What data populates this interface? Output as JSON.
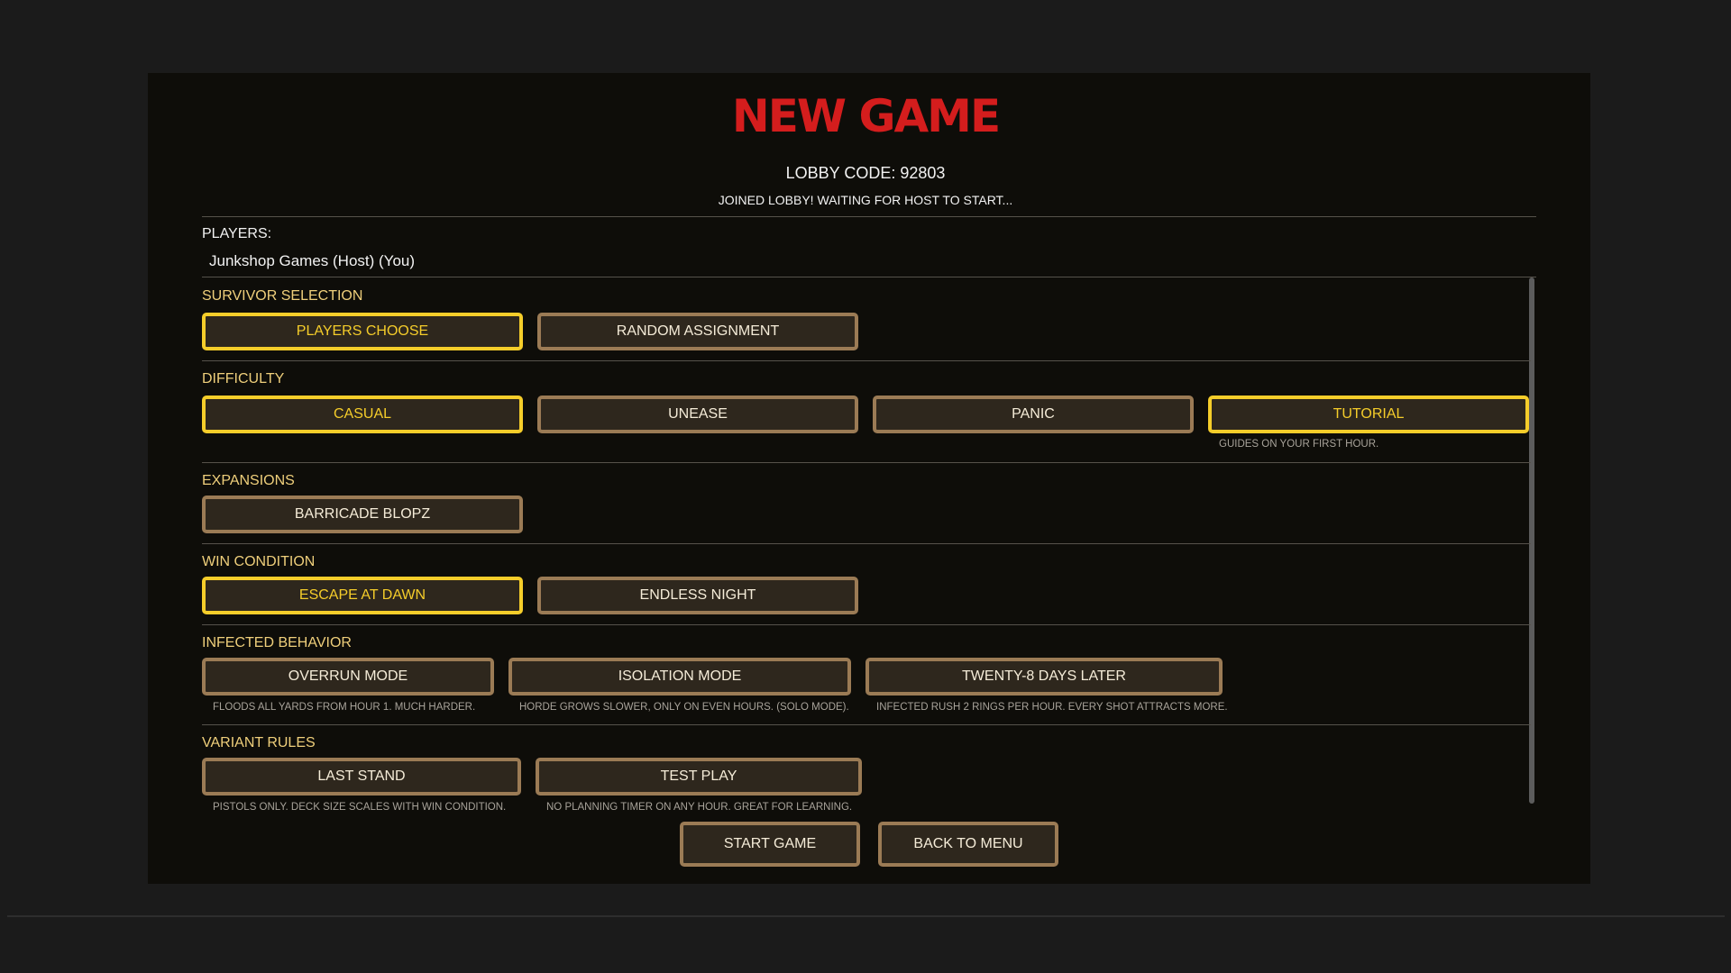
{
  "header": {
    "title": "NEW GAME",
    "lobby_code": "LOBBY CODE: 92803",
    "status": "JOINED LOBBY! WAITING FOR HOST TO START..."
  },
  "players": {
    "label": "PLAYERS:",
    "list": [
      "Junkshop Games (Host) (You)"
    ]
  },
  "sections": {
    "survivor": {
      "label": "SURVIVOR SELECTION",
      "options": [
        {
          "label": "PLAYERS CHOOSE",
          "selected": true
        },
        {
          "label": "RANDOM ASSIGNMENT",
          "selected": false
        }
      ]
    },
    "difficulty": {
      "label": "DIFFICULTY",
      "options": [
        {
          "label": "CASUAL",
          "selected": true
        },
        {
          "label": "UNEASE",
          "selected": false
        },
        {
          "label": "PANIC",
          "selected": false
        },
        {
          "label": "TUTORIAL",
          "selected": true,
          "hint": "GUIDES ON YOUR FIRST HOUR."
        }
      ]
    },
    "expansions": {
      "label": "EXPANSIONS",
      "options": [
        {
          "label": "BARRICADE BLOPZ",
          "selected": false
        }
      ]
    },
    "win_condition": {
      "label": "WIN CONDITION",
      "options": [
        {
          "label": "ESCAPE AT DAWN",
          "selected": true
        },
        {
          "label": "ENDLESS NIGHT",
          "selected": false
        }
      ]
    },
    "infected_behavior": {
      "label": "INFECTED BEHAVIOR",
      "options": [
        {
          "label": "OVERRUN MODE",
          "selected": false,
          "hint": "FLOODS ALL YARDS FROM HOUR 1. MUCH HARDER."
        },
        {
          "label": "ISOLATION MODE",
          "selected": false,
          "hint": "HORDE GROWS SLOWER, ONLY ON EVEN HOURS. (SOLO MODE)."
        },
        {
          "label": "TWENTY-8 DAYS LATER",
          "selected": false,
          "hint": "INFECTED RUSH 2 RINGS PER HOUR. EVERY SHOT ATTRACTS MORE."
        }
      ]
    },
    "variant_rules": {
      "label": "VARIANT RULES",
      "options": [
        {
          "label": "LAST STAND",
          "selected": false,
          "hint": "PISTOLS ONLY. DECK SIZE SCALES WITH WIN CONDITION."
        },
        {
          "label": "TEST PLAY",
          "selected": false,
          "hint": "NO PLANNING TIMER ON ANY HOUR. GREAT FOR LEARNING."
        }
      ]
    }
  },
  "footer": {
    "start_label": "START GAME",
    "back_label": "BACK TO MENU"
  },
  "colors": {
    "title_red": "#d41d1d",
    "section_gold": "#efcf7b",
    "selected_yellow": "#f5cd2a",
    "button_border": "#9b7b55",
    "panel_bg": "#0e0d09"
  }
}
